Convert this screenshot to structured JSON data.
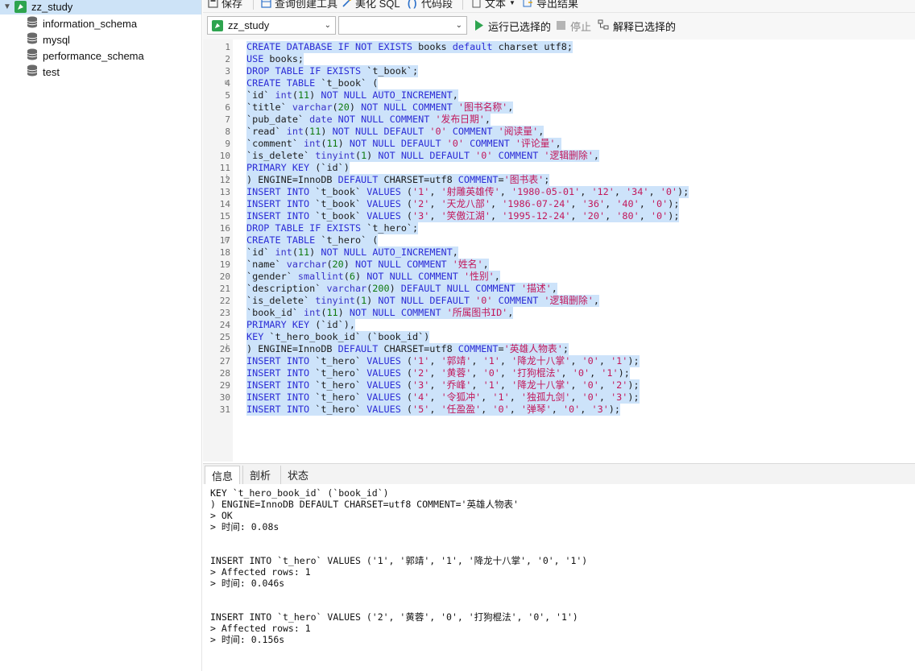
{
  "sidebar": {
    "connection": "zz_study",
    "databases": [
      "information_schema",
      "mysql",
      "performance_schema",
      "test"
    ]
  },
  "toolbar": {
    "items": [
      "保存",
      "查询创建工具",
      "美化 SQL",
      "代码段",
      "文本",
      "导出结果"
    ]
  },
  "querybar": {
    "connection_select": "zz_study",
    "database_select": "",
    "run_selected": "运行已选择的",
    "stop": "停止",
    "explain_selected": "解释已选择的"
  },
  "editor": {
    "lines": [
      "CREATE DATABASE IF NOT EXISTS books default charset utf8;",
      "USE books;",
      "DROP TABLE IF EXISTS `t_book`;",
      "CREATE TABLE `t_book` (",
      "`id` int(11) NOT NULL AUTO_INCREMENT,",
      "`title` varchar(20) NOT NULL COMMENT '图书名称',",
      "`pub_date` date NOT NULL COMMENT '发布日期',",
      "`read` int(11) NOT NULL DEFAULT '0' COMMENT '阅读量',",
      "`comment` int(11) NOT NULL DEFAULT '0' COMMENT '评论量',",
      "`is_delete` tinyint(1) NOT NULL DEFAULT '0' COMMENT '逻辑删除',",
      "PRIMARY KEY (`id`)",
      ") ENGINE=InnoDB DEFAULT CHARSET=utf8 COMMENT='图书表';",
      "INSERT INTO `t_book` VALUES ('1', '射雕英雄传', '1980-05-01', '12', '34', '0');",
      "INSERT INTO `t_book` VALUES ('2', '天龙八部', '1986-07-24', '36', '40', '0');",
      "INSERT INTO `t_book` VALUES ('3', '笑傲江湖', '1995-12-24', '20', '80', '0');",
      "DROP TABLE IF EXISTS `t_hero`;",
      "CREATE TABLE `t_hero` (",
      "`id` int(11) NOT NULL AUTO_INCREMENT,",
      "`name` varchar(20) NOT NULL COMMENT '姓名',",
      "`gender` smallint(6) NOT NULL COMMENT '性别',",
      "`description` varchar(200) DEFAULT NULL COMMENT '描述',",
      "`is_delete` tinyint(1) NOT NULL DEFAULT '0' COMMENT '逻辑删除',",
      "`book_id` int(11) NOT NULL COMMENT '所属图书ID',",
      "PRIMARY KEY (`id`),",
      "KEY `t_hero_book_id` (`book_id`)",
      ") ENGINE=InnoDB DEFAULT CHARSET=utf8 COMMENT='英雄人物表';",
      "INSERT INTO `t_hero` VALUES ('1', '郭靖', '1', '降龙十八掌', '0', '1');",
      "INSERT INTO `t_hero` VALUES ('2', '黄蓉', '0', '打狗棍法', '0', '1');",
      "INSERT INTO `t_hero` VALUES ('3', '乔峰', '1', '降龙十八掌', '0', '2');",
      "INSERT INTO `t_hero` VALUES ('4', '令狐冲', '1', '独孤九剑', '0', '3');",
      "INSERT INTO `t_hero` VALUES ('5', '任盈盈', '0', '弹琴', '0', '3');"
    ]
  },
  "result": {
    "tabs": [
      "信息",
      "剖析",
      "状态"
    ],
    "output_lines": [
      "KEY `t_hero_book_id` (`book_id`)",
      ") ENGINE=InnoDB DEFAULT CHARSET=utf8 COMMENT='英雄人物表'",
      "> OK",
      "> 时间: 0.08s",
      "",
      "",
      "INSERT INTO `t_hero` VALUES ('1', '郭靖', '1', '降龙十八掌', '0', '1')",
      "> Affected rows: 1",
      "> 时间: 0.046s",
      "",
      "",
      "INSERT INTO `t_hero` VALUES ('2', '黄蓉', '0', '打狗棍法', '0', '1')",
      "> Affected rows: 1",
      "> 时间: 0.156s"
    ]
  },
  "colors": {
    "selection": "#cde3fa",
    "keyword": "#2c2cd6",
    "string": "#c2185b",
    "number": "#0e7a0e",
    "connection_icon": "#2ea44f",
    "run_icon": "#2ea44f"
  }
}
